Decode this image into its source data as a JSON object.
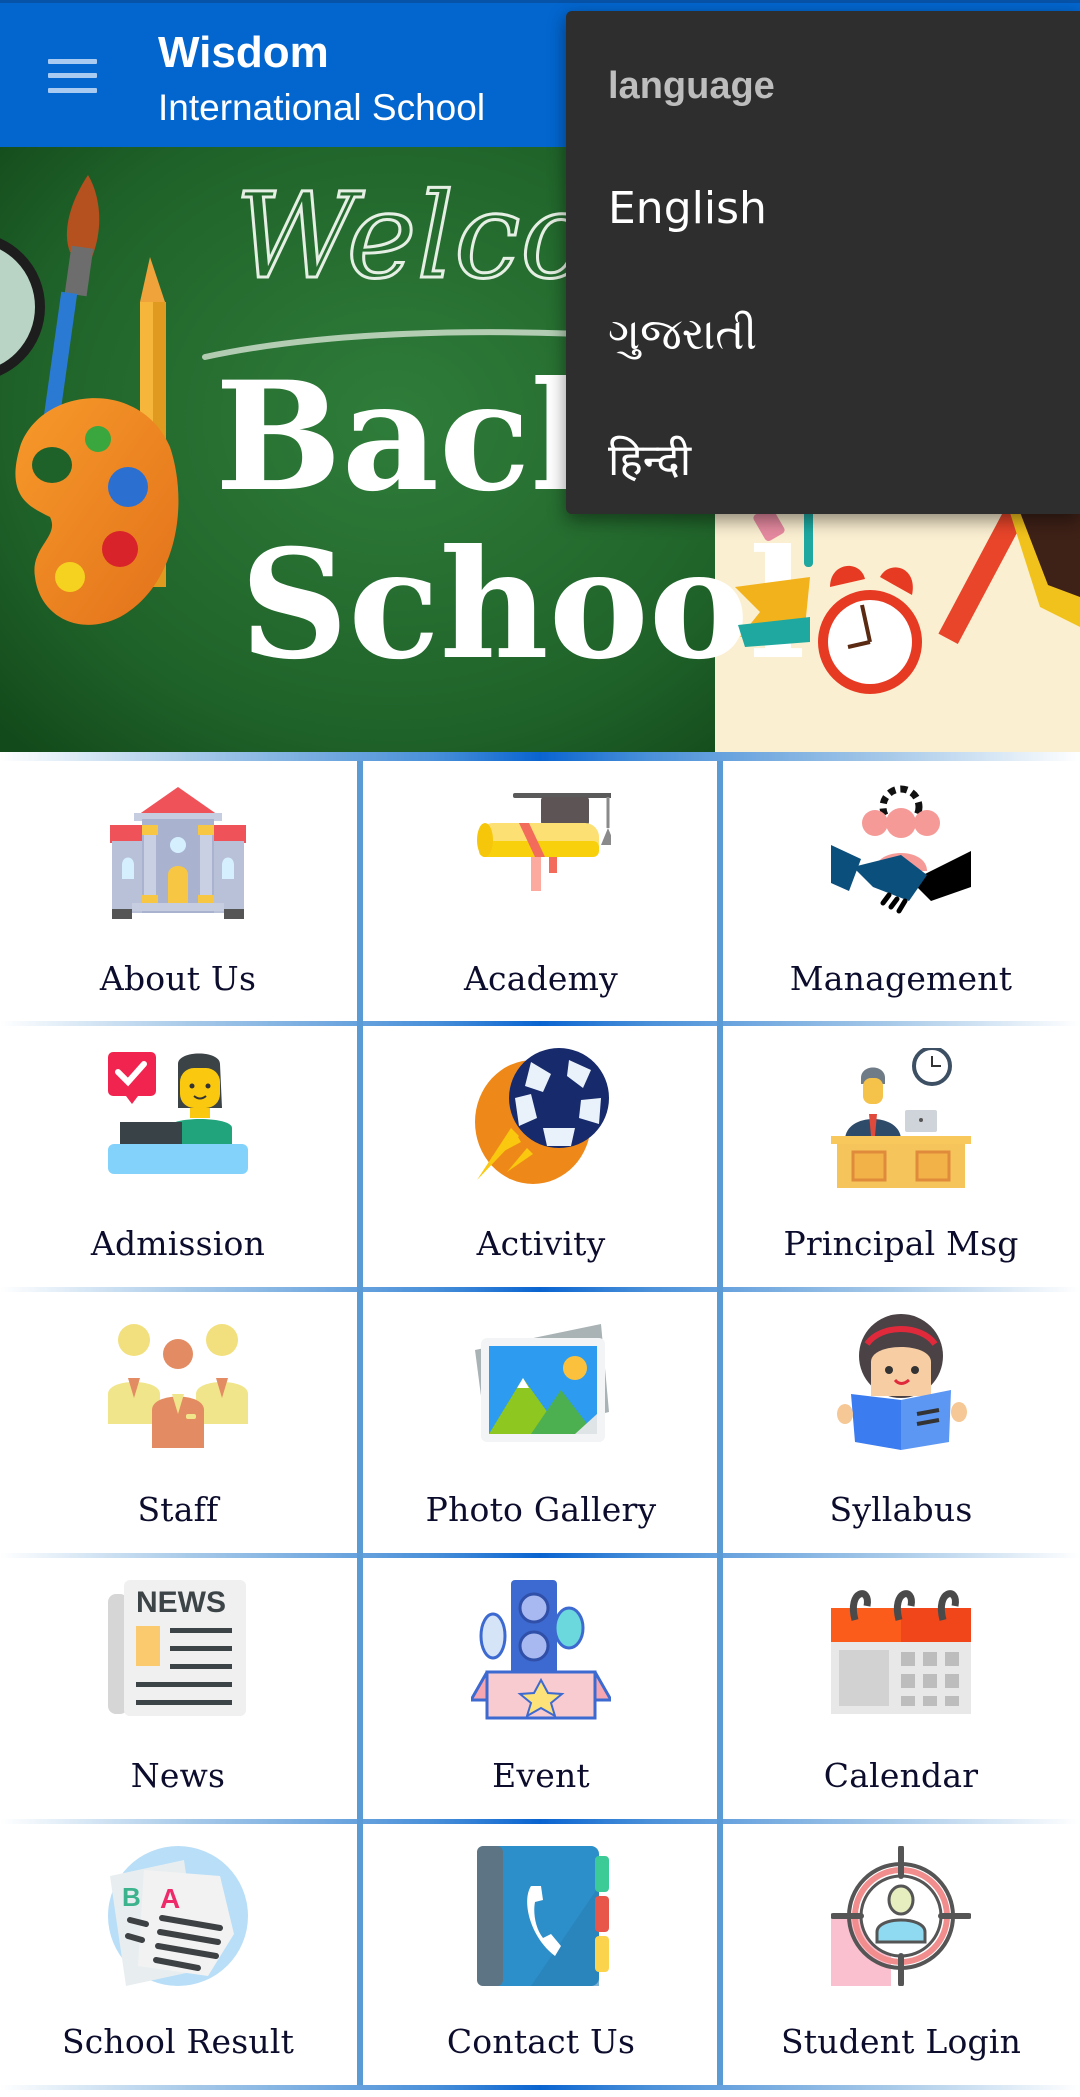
{
  "app": {
    "title": "Wisdom",
    "subtitle": "International School",
    "header_color": "#0366cf"
  },
  "toolbar": {
    "menu_icon": "hamburger-menu-icon"
  },
  "banner": {
    "welcome_text": "Welcome",
    "headline_line1": "Back to",
    "headline_line2": "School"
  },
  "grid": {
    "items": [
      {
        "label": "About Us",
        "icon": "school-building-icon"
      },
      {
        "label": "Academy",
        "icon": "graduation-scroll-icon"
      },
      {
        "label": "Management",
        "icon": "management-handshake-icon"
      },
      {
        "label": "Admission",
        "icon": "admission-desk-icon"
      },
      {
        "label": "Activity",
        "icon": "soccer-ball-icon"
      },
      {
        "label": "Principal Msg",
        "icon": "principal-desk-icon"
      },
      {
        "label": "Staff",
        "icon": "staff-people-icon"
      },
      {
        "label": "Photo Gallery",
        "icon": "photo-gallery-icon"
      },
      {
        "label": "Syllabus",
        "icon": "reading-girl-icon"
      },
      {
        "label": "News",
        "icon": "newspaper-icon"
      },
      {
        "label": "Event",
        "icon": "event-box-icon"
      },
      {
        "label": "Calendar",
        "icon": "calendar-icon"
      },
      {
        "label": "School Result",
        "icon": "result-papers-icon"
      },
      {
        "label": "Contact Us",
        "icon": "phone-book-icon"
      },
      {
        "label": "Student Login",
        "icon": "student-target-icon"
      }
    ]
  },
  "language_menu": {
    "title": "language",
    "options": [
      "English",
      "ગુજરાતી",
      "हिन्दी"
    ]
  }
}
